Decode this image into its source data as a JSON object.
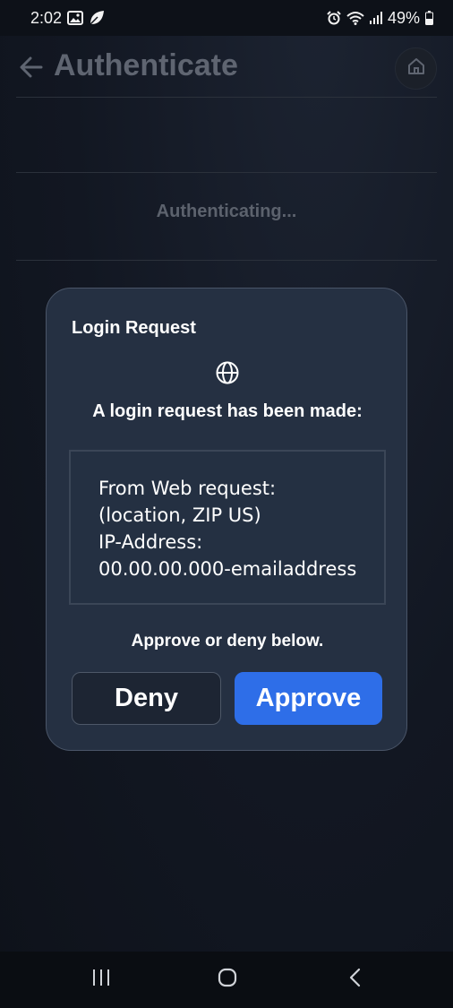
{
  "status_bar": {
    "time": "2:02",
    "battery": "49%",
    "icons": [
      "gallery-icon",
      "leaf-icon",
      "alarm-icon",
      "wifi-icon",
      "signal-icon",
      "battery-icon"
    ]
  },
  "header": {
    "title": "Authenticate",
    "back_icon": "arrow-left-icon",
    "home_icon": "home-icon"
  },
  "main": {
    "status_text": "Authenticating..."
  },
  "dialog": {
    "title": "Login Request",
    "icon": "globe-icon",
    "message": "A login request has been made:",
    "details": [
      "From Web request:",
      "(location, ZIP US)",
      "IP-Address:",
      "00.00.00.000-emailaddress"
    ],
    "footer_text": "Approve or deny below.",
    "deny_label": "Deny",
    "approve_label": "Approve"
  },
  "nav_bar": {
    "icons": [
      "recents-icon",
      "home-circle-icon",
      "back-chevron-icon"
    ]
  },
  "colors": {
    "background": "#121722",
    "dialog_bg": "#253042",
    "accent": "#2e6ee8",
    "dimmed_text": "#5f6571"
  }
}
